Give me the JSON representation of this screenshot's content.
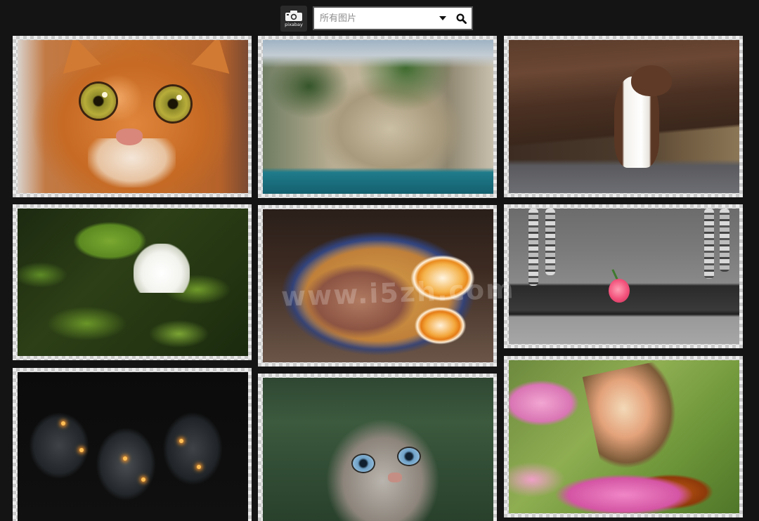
{
  "header": {
    "logo_text": "pixabay",
    "search": {
      "value": "",
      "placeholder": "所有图片"
    }
  },
  "colors": {
    "page_background": "#141414",
    "tile_border_light": "#ececec",
    "tile_border_dark": "#c9c9c9"
  },
  "icons": {
    "logo": "camera-icon",
    "dropdown": "caret-down-icon",
    "search": "search-icon"
  },
  "gallery": {
    "columns": [
      {
        "photos": [
          {
            "subject": "orange-cat"
          },
          {
            "subject": "water-lily"
          },
          {
            "subject": "light-bulbs"
          }
        ]
      },
      {
        "photos": [
          {
            "subject": "coastal-cliffs"
          },
          {
            "subject": "ramen-bowl"
          },
          {
            "subject": "tabby-cat"
          }
        ]
      },
      {
        "photos": [
          {
            "subject": "weasel"
          },
          {
            "subject": "swing-with-rose"
          },
          {
            "subject": "butterfly-on-flower"
          }
        ]
      }
    ]
  },
  "watermark": {
    "text": "www.i5zh.com"
  }
}
